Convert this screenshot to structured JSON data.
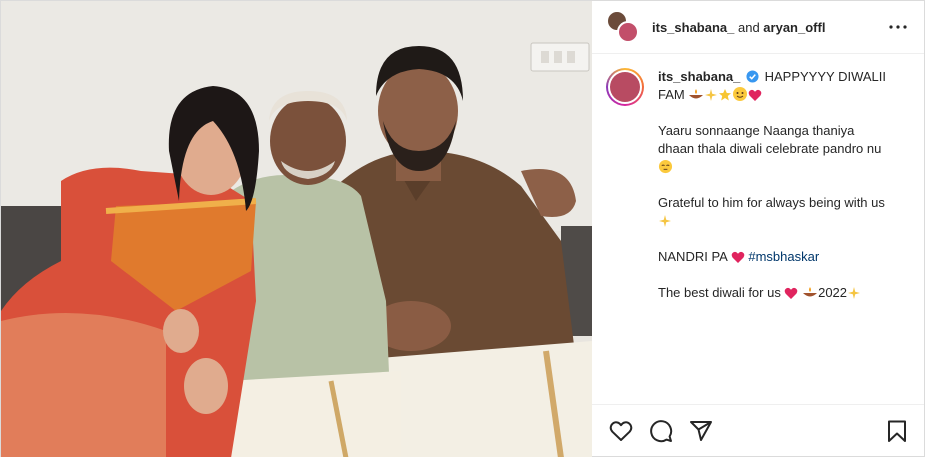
{
  "header": {
    "user1": "its_shabana_",
    "and_text": " and ",
    "user2": "aryan_offl"
  },
  "caption": {
    "username": "its_shabana_",
    "line1_text": " HAPPYYYY DIWALII FAM",
    "para2": "Yaaru sonnaange Naanga thaniya dhaan thala diwali celebrate pandro nu",
    "para3": "Grateful to him for always being with us",
    "para4_text": "NANDRI PA",
    "para4_hashtag": "#msbhaskar",
    "para5_text": "The best diwali for us",
    "para5_year": "2022"
  },
  "colors": {
    "verified": "#3897f0",
    "heart": "#e0245e",
    "hashtag": "#00376b",
    "saree": "#d9503a",
    "saree_border": "#e58a2b"
  },
  "icons": {
    "more": "more-dots-icon",
    "like": "heart-icon",
    "comment": "comment-icon",
    "share": "share-plane-icon",
    "save": "bookmark-icon"
  }
}
